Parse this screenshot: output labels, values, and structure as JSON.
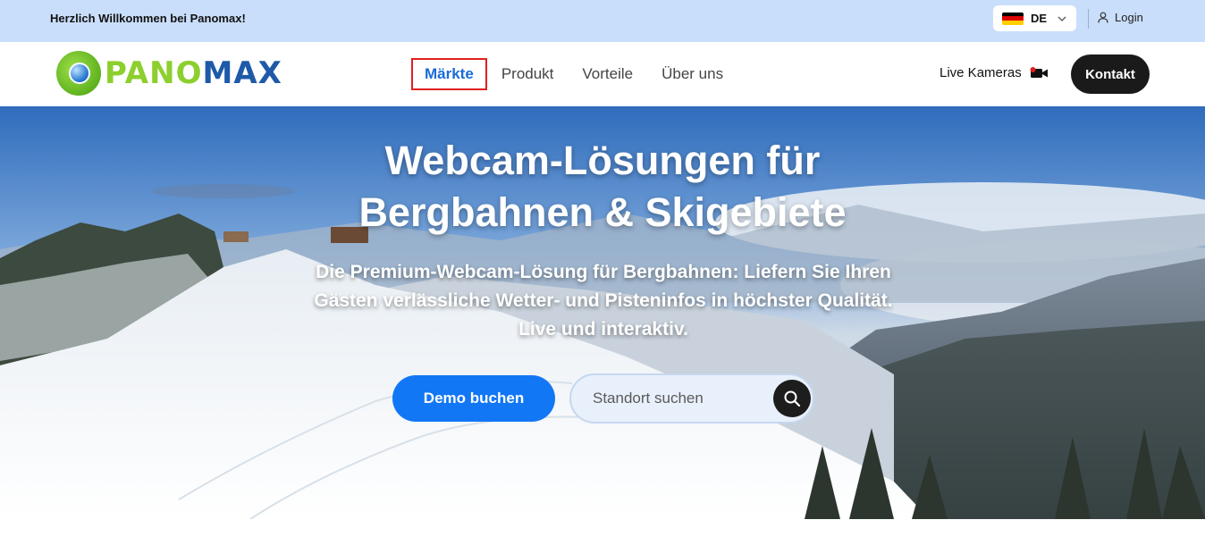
{
  "topbar": {
    "welcome": "Herzlich Willkommen bei Panomax!",
    "language": "DE",
    "login": "Login"
  },
  "nav": {
    "logo_pano": "PANO",
    "logo_max": "MAX",
    "links": [
      "Märkte",
      "Produkt",
      "Vorteile",
      "Über uns"
    ],
    "active": "Märkte",
    "live_cameras": "Live Kameras",
    "contact": "Kontakt"
  },
  "hero": {
    "title_line1": "Webcam-Lösungen für",
    "title_line2": "Bergbahnen & Skigebiete",
    "subtitle_line1": "Die Premium-Webcam-Lösung für Bergbahnen: Liefern Sie Ihren",
    "subtitle_line2": "Gästen verlässliche Wetter- und Pisteninfos in höchster Qualität.",
    "subtitle_line3": "Live und interaktiv.",
    "demo_button": "Demo buchen",
    "search_placeholder": "Standort suchen"
  },
  "colors": {
    "topbar_bg": "#c9defa",
    "accent_blue": "#1277f5",
    "active_link": "#1a6bd8",
    "highlight_border": "#e02020",
    "dark_button": "#1a1a1a"
  },
  "icons": [
    "germany-flag-icon",
    "chevron-down-icon",
    "user-icon",
    "video-camera-icon",
    "search-icon"
  ]
}
